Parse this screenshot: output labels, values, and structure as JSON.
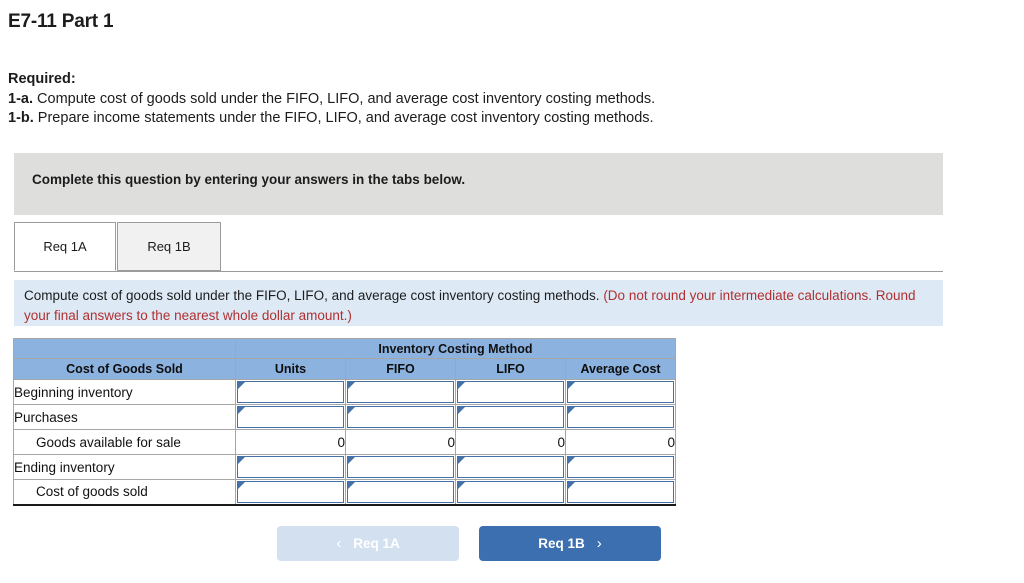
{
  "page_title": "E7-11 Part 1",
  "required": {
    "heading": "Required:",
    "items": [
      {
        "label": "1-a.",
        "text": " Compute cost of goods sold under the FIFO, LIFO, and average cost inventory costing methods."
      },
      {
        "label": "1-b.",
        "text": " Prepare income statements under the FIFO, LIFO, and average cost inventory costing methods."
      }
    ]
  },
  "banner": {
    "text": "Complete this question by entering your answers in the tabs below."
  },
  "tabs": [
    {
      "label": "Req 1A",
      "active": true
    },
    {
      "label": "Req 1B",
      "active": false
    }
  ],
  "instruction": {
    "black_text": "Compute cost of goods sold under the FIFO, LIFO, and average cost inventory costing methods. ",
    "red_text": "(Do not round your intermediate calculations. Round your final answers to the nearest whole dollar amount.)"
  },
  "table": {
    "group_header": "Inventory Costing Method",
    "columns": [
      "Cost of Goods Sold",
      "Units",
      "FIFO",
      "LIFO",
      "Average Cost"
    ],
    "rows": [
      {
        "label": "Beginning inventory",
        "indent": false,
        "type": "input",
        "values": [
          "",
          "",
          "",
          ""
        ]
      },
      {
        "label": "Purchases",
        "indent": false,
        "type": "input",
        "values": [
          "",
          "",
          "",
          ""
        ]
      },
      {
        "label": "Goods available for sale",
        "indent": true,
        "type": "value",
        "values": [
          "0",
          "0",
          "0",
          "0"
        ]
      },
      {
        "label": "Ending inventory",
        "indent": false,
        "type": "input",
        "values": [
          "",
          "",
          "",
          ""
        ]
      },
      {
        "label": "Cost of goods sold",
        "indent": true,
        "type": "input",
        "values": [
          "",
          "",
          "",
          ""
        ]
      }
    ]
  },
  "nav": {
    "prev_label": "Req 1A",
    "prev_icon": "chevron-left-icon",
    "next_label": "Req 1B",
    "next_icon": "chevron-right-icon"
  },
  "colors": {
    "header_blue": "#8cb2e0",
    "banner_gray": "#dededd",
    "instruction_blue": "#ddeaf6",
    "red_text": "#b03030",
    "next_button": "#3c6fb0",
    "prev_button": "#d3e0ef",
    "cell_border_blue": "#4472a8"
  }
}
